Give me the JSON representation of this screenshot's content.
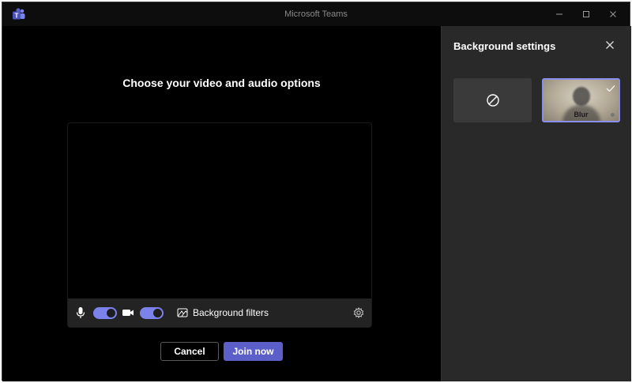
{
  "window": {
    "title": "Microsoft Teams",
    "app_icon": "teams-logo",
    "controls": [
      "minimize-icon",
      "maximize-icon",
      "close-icon"
    ]
  },
  "main": {
    "heading": "Choose your video and audio options",
    "controls": {
      "mic_icon": "microphone-icon",
      "mic_on": true,
      "camera_icon": "video-camera-icon",
      "camera_on": true,
      "filters_icon": "background-filters-icon",
      "filters_label": "Background filters",
      "settings_icon": "gear-icon"
    },
    "buttons": {
      "cancel": "Cancel",
      "join": "Join now"
    }
  },
  "panel": {
    "title": "Background settings",
    "close_icon": "close-icon",
    "options": [
      {
        "icon": "no-background-icon",
        "label": ""
      },
      {
        "label": "Blur",
        "selected": true
      }
    ]
  },
  "colors": {
    "accent": "#5b5fc7",
    "toggle_on": "#7b83eb",
    "panel_bg": "#292929",
    "window_bg": "#000000"
  }
}
